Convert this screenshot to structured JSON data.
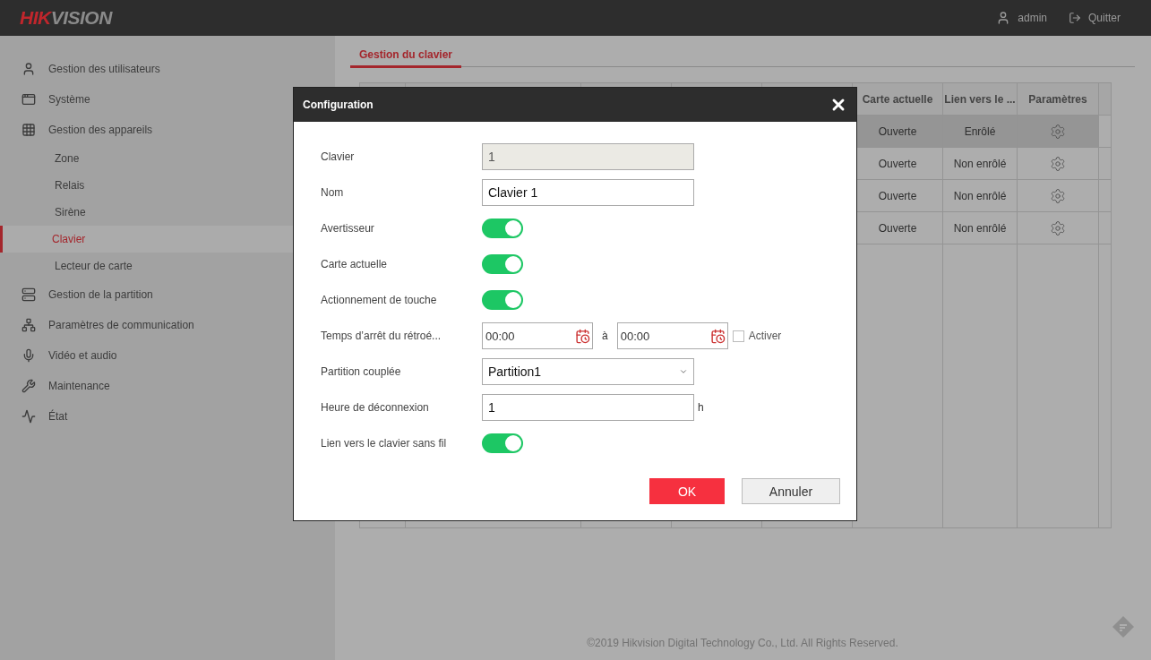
{
  "header": {
    "logo": {
      "accent": "HIK",
      "rest": "VISION"
    },
    "user": "admin",
    "logout": "Quitter"
  },
  "sidebar": {
    "items": [
      {
        "label": "Gestion des utilisateurs",
        "selected": false
      },
      {
        "label": "Système",
        "selected": false
      },
      {
        "label": "Gestion des appareils",
        "selected": false,
        "children": [
          {
            "label": "Zone",
            "selected": false
          },
          {
            "label": "Relais",
            "selected": false
          },
          {
            "label": "Sirène",
            "selected": false
          },
          {
            "label": "Clavier",
            "selected": true
          },
          {
            "label": "Lecteur de carte",
            "selected": false
          }
        ]
      },
      {
        "label": "Gestion de la partition",
        "selected": false
      },
      {
        "label": "Paramètres de communication",
        "selected": false
      },
      {
        "label": "Vidéo et audio",
        "selected": false
      },
      {
        "label": "Maintenance",
        "selected": false
      },
      {
        "label": "État",
        "selected": false
      }
    ]
  },
  "tabs": [
    {
      "label": "Gestion du clavier",
      "selected": true
    }
  ],
  "table": {
    "columns": [
      "Carte actuelle",
      "Lien vers le ...",
      "Paramètres"
    ],
    "rows": [
      {
        "carte_actuelle": "Ouverte",
        "lien": "Enrôlé",
        "selected": true
      },
      {
        "carte_actuelle": "Ouverte",
        "lien": "Non enrôlé",
        "selected": false
      },
      {
        "carte_actuelle": "Ouverte",
        "lien": "Non enrôlé",
        "selected": false
      },
      {
        "carte_actuelle": "Ouverte",
        "lien": "Non enrôlé",
        "selected": false
      }
    ]
  },
  "dialog": {
    "title": "Configuration",
    "fields": [
      {
        "kind": "readonly",
        "label": "Clavier",
        "value": "1"
      },
      {
        "kind": "text",
        "label": "Nom",
        "value": "Clavier 1"
      },
      {
        "kind": "toggle",
        "label": "Avertisseur",
        "on": true
      },
      {
        "kind": "toggle",
        "label": "Carte actuelle",
        "on": true
      },
      {
        "kind": "toggle",
        "label": "Actionnement de touche",
        "on": true
      },
      {
        "kind": "timerange",
        "label": "Temps d’arrêt du rétroé...",
        "from": "00:00",
        "separator": "à",
        "to": "00:00",
        "checkbox_label": "Activer",
        "checked": false
      },
      {
        "kind": "select",
        "label": "Partition couplée",
        "value": "Partition1"
      },
      {
        "kind": "unit",
        "label": "Heure de déconnexion",
        "value": "1",
        "unit": "h"
      },
      {
        "kind": "toggle",
        "label": "Lien vers le clavier sans fil",
        "on": true
      }
    ],
    "buttons": [
      {
        "kind": "primary",
        "label": "OK"
      },
      {
        "kind": "secondary",
        "label": "Annuler"
      }
    ]
  },
  "footer": "©2019 Hikvision Digital Technology Co., Ltd. All Rights Reserved."
}
